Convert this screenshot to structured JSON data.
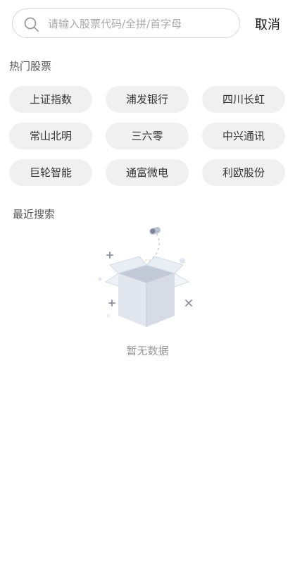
{
  "search": {
    "placeholder": "请输入股票代码/全拼/首字母",
    "value": "",
    "cancel_label": "取消"
  },
  "hot_stocks": {
    "title": "热门股票",
    "items": [
      {
        "label": "上证指数"
      },
      {
        "label": "浦发银行"
      },
      {
        "label": "四川长虹"
      },
      {
        "label": "常山北明"
      },
      {
        "label": "三六零"
      },
      {
        "label": "中兴通讯"
      },
      {
        "label": "巨轮智能"
      },
      {
        "label": "通富微电"
      },
      {
        "label": "利欧股份"
      }
    ]
  },
  "recent_search": {
    "title": "最近搜索",
    "empty_text": "暂无数据",
    "empty_icon": "empty-box-icon"
  },
  "colors": {
    "chip_background": "#f0f0f0",
    "border": "#d8d8d8",
    "muted_text": "#9a9a9a"
  }
}
